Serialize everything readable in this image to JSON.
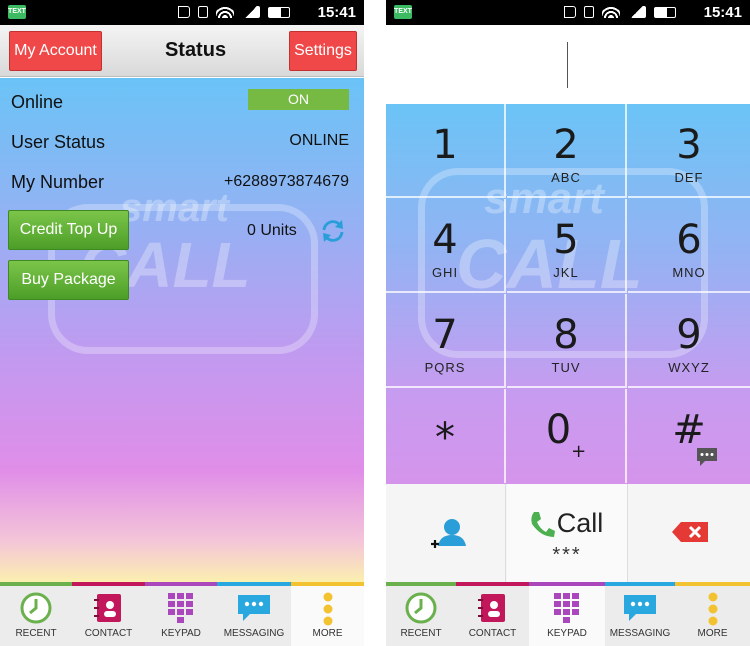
{
  "status_bar": {
    "app_badge": "TEXT",
    "time": "15:41"
  },
  "account_screen": {
    "my_account_label": "My Account",
    "title": "Status",
    "settings_label": "Settings",
    "rows": [
      {
        "label": "Online",
        "value": "ON"
      },
      {
        "label": "User Status",
        "value": "ONLINE"
      },
      {
        "label": "My Number",
        "value": "+6288973874679"
      }
    ],
    "credit_top_up_label": "Credit Top Up",
    "buy_package_label": "Buy Package",
    "units": "0 Units"
  },
  "keypad_screen": {
    "keys": [
      {
        "digit": "1",
        "letters": ""
      },
      {
        "digit": "2",
        "letters": "ABC"
      },
      {
        "digit": "3",
        "letters": "DEF"
      },
      {
        "digit": "4",
        "letters": "GHI"
      },
      {
        "digit": "5",
        "letters": "JKL"
      },
      {
        "digit": "6",
        "letters": "MNO"
      },
      {
        "digit": "7",
        "letters": "PQRS"
      },
      {
        "digit": "8",
        "letters": "TUV"
      },
      {
        "digit": "9",
        "letters": "WXYZ"
      },
      {
        "digit": "*",
        "letters": ""
      },
      {
        "digit": "0",
        "letters": "",
        "sub": "+"
      },
      {
        "digit": "#",
        "letters": ""
      }
    ],
    "call_label": "Call",
    "call_sub": "***"
  },
  "watermark": {
    "line1": "smart",
    "line2": "CALL"
  },
  "nav": {
    "items": [
      {
        "label": "RECENT",
        "icon": "clock-icon",
        "color": "#6ab04c"
      },
      {
        "label": "CONTACT",
        "icon": "contact-book-icon",
        "color": "#c2185b"
      },
      {
        "label": "KEYPAD",
        "icon": "keypad-grid-icon",
        "color": "#ab47bc"
      },
      {
        "label": "MESSAGING",
        "icon": "chat-bubble-icon",
        "color": "#29a8e0"
      },
      {
        "label": "MORE",
        "icon": "more-dots-icon",
        "color": "#f2c230"
      }
    ],
    "left_active": "MORE",
    "right_active": "KEYPAD"
  },
  "colors": {
    "red_button": "#f04848",
    "green_button": "#5fae34",
    "toggle_on": "#76b943",
    "accent_blue": "#2a9ed8"
  }
}
